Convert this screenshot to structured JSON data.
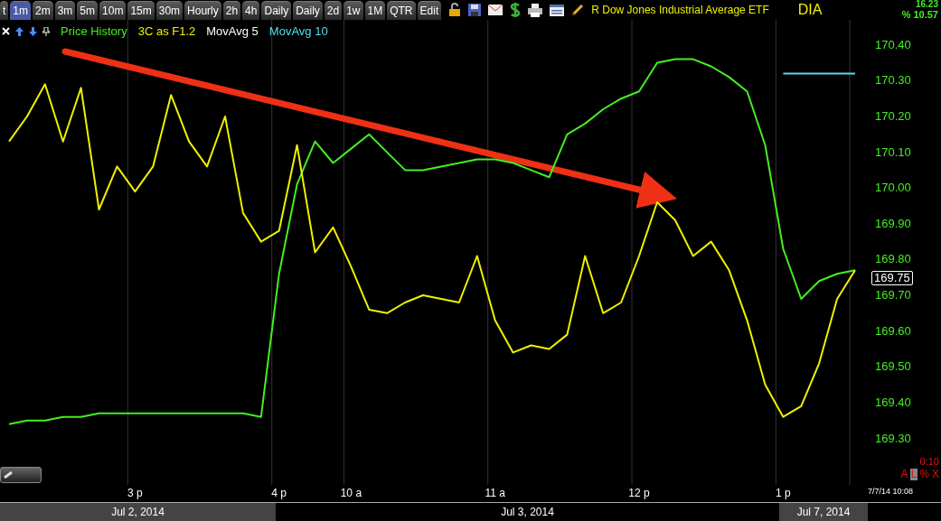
{
  "toolbar": {
    "tabs": [
      {
        "label": "t",
        "selected": false
      },
      {
        "label": "1m",
        "selected": true
      },
      {
        "label": "2m",
        "selected": false
      },
      {
        "label": "3m",
        "selected": false
      },
      {
        "label": "5m",
        "selected": false
      },
      {
        "label": "10m",
        "selected": false
      },
      {
        "label": "15m",
        "selected": false
      },
      {
        "label": "30m",
        "selected": false
      },
      {
        "label": "Hourly",
        "selected": false
      },
      {
        "label": "2h",
        "selected": false
      },
      {
        "label": "4h",
        "selected": false
      },
      {
        "label": "Daily",
        "selected": false
      },
      {
        "label": "Daily",
        "selected": false
      },
      {
        "label": "2d",
        "selected": false
      },
      {
        "label": "1w",
        "selected": false
      },
      {
        "label": "1M",
        "selected": false
      },
      {
        "label": "QTR",
        "selected": false
      },
      {
        "label": "Edit",
        "selected": false
      }
    ],
    "title": "R Dow Jones Industrial Average ETF",
    "symbol": "DIA",
    "change": "16.23",
    "change_percent": "% 10.57"
  },
  "legend": [
    {
      "label": "MovAvg 5",
      "color": "#ffffff"
    }
  ],
  "chart_data": {
    "type": "line",
    "categories": [
      null,
      null,
      null,
      null,
      null,
      null,
      null,
      "3 p",
      null,
      null,
      null,
      null,
      null,
      null,
      null,
      "4 p",
      null,
      null,
      null,
      "10 a",
      null,
      null,
      null,
      null,
      null,
      null,
      null,
      "11 a",
      null,
      null,
      null,
      null,
      null,
      null,
      null,
      "12 p",
      null,
      null,
      null,
      null,
      null,
      null,
      null,
      "1 p",
      null,
      null,
      null,
      null
    ],
    "series": [
      {
        "name": "Price History",
        "color": "#44ee22",
        "values": [
          169.34,
          169.35,
          169.35,
          169.36,
          169.36,
          169.37,
          169.37,
          169.37,
          169.37,
          169.37,
          169.37,
          169.37,
          169.37,
          169.37,
          169.36,
          169.76,
          170.01,
          170.13,
          170.07,
          170.11,
          170.15,
          170.1,
          170.05,
          170.05,
          170.06,
          170.07,
          170.08,
          170.08,
          170.07,
          170.05,
          170.03,
          170.15,
          170.18,
          170.22,
          170.25,
          170.27,
          170.35,
          170.36,
          170.36,
          170.34,
          170.31,
          170.27,
          170.12,
          169.83,
          169.69,
          169.74,
          169.76,
          169.77
        ]
      },
      {
        "name": "3C as F1.2",
        "color": "#f0f000",
        "values": [
          170.13,
          170.2,
          170.29,
          170.13,
          170.28,
          169.94,
          170.06,
          169.99,
          170.06,
          170.26,
          170.13,
          170.06,
          170.2,
          169.93,
          169.85,
          169.88,
          170.12,
          169.82,
          169.89,
          169.78,
          169.66,
          169.65,
          169.68,
          169.7,
          169.69,
          169.68,
          169.81,
          169.63,
          169.54,
          169.56,
          169.55,
          169.59,
          169.81,
          169.65,
          169.68,
          169.81,
          169.96,
          169.91,
          169.81,
          169.85,
          169.77,
          169.63,
          169.45,
          169.36,
          169.39,
          169.51,
          169.69,
          169.77
        ]
      },
      {
        "name": "MovAvg 10",
        "color": "#55ddee",
        "values": [
          null,
          null,
          null,
          null,
          null,
          null,
          null,
          null,
          null,
          null,
          null,
          null,
          null,
          null,
          null,
          null,
          null,
          null,
          null,
          null,
          null,
          null,
          null,
          null,
          null,
          null,
          null,
          null,
          null,
          null,
          null,
          null,
          null,
          null,
          null,
          null,
          null,
          null,
          null,
          null,
          null,
          null,
          null,
          170.32,
          170.32,
          170.32,
          170.32,
          170.32
        ]
      }
    ],
    "ylim": [
      169.17,
      170.47
    ],
    "yticks": [
      {
        "value": 170.4,
        "label": "170.40"
      },
      {
        "value": 170.3,
        "label": "170.30"
      },
      {
        "value": 170.2,
        "label": "170.20"
      },
      {
        "value": 170.1,
        "label": "170.10"
      },
      {
        "value": 170,
        "label": "170.00"
      },
      {
        "value": 169.9,
        "label": "169.90"
      },
      {
        "value": 169.8,
        "label": "169.80"
      },
      {
        "value": 169.7,
        "label": "169.70"
      },
      {
        "value": 169.6,
        "label": "169.60"
      },
      {
        "value": 169.5,
        "label": "169.50"
      },
      {
        "value": 169.4,
        "label": "169.40"
      },
      {
        "value": 169.3,
        "label": "169.30"
      }
    ]
  },
  "last_price": "169.75",
  "timestamp": "7/7/14 10:08",
  "scale": {
    "value": "0:10",
    "buttons": [
      {
        "label": "A",
        "selected": false
      },
      {
        "label": "L",
        "selected": true
      },
      {
        "label": "%",
        "selected": false
      },
      {
        "label": "X",
        "selected": false
      }
    ]
  },
  "dates": [
    {
      "label": "Jul 2, 2014",
      "shaded": true
    },
    {
      "label": "Jul 3, 2014",
      "shaded": false
    },
    {
      "label": "Jul 7, 2014",
      "shaded": true
    }
  ]
}
